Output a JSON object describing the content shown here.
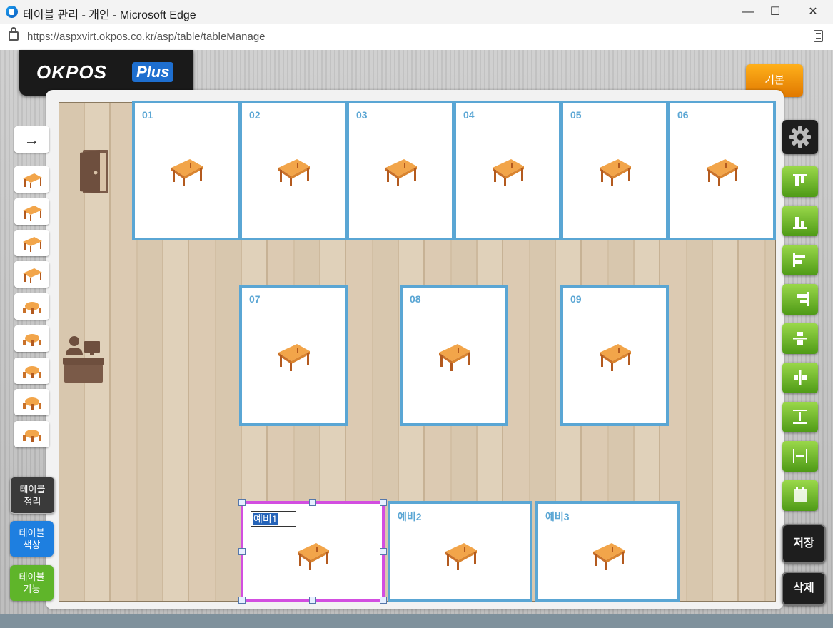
{
  "window": {
    "title": "테이블 관리 - 개인 - Microsoft Edge",
    "minimize": "—",
    "maximize": "☐",
    "close": "✕"
  },
  "address": {
    "url": "https://aspxvirt.okpos.co.kr/asp/table/tableManage"
  },
  "logo": {
    "brand": "OKPOS",
    "plus": "Plus"
  },
  "header": {
    "basic_label": "기본"
  },
  "tables": [
    {
      "label": "01"
    },
    {
      "label": "02"
    },
    {
      "label": "03"
    },
    {
      "label": "04"
    },
    {
      "label": "05"
    },
    {
      "label": "06"
    },
    {
      "label": "07"
    },
    {
      "label": "08"
    },
    {
      "label": "09"
    },
    {
      "label": "예비1"
    },
    {
      "label": "예비2"
    },
    {
      "label": "예비3"
    }
  ],
  "left_palette": {
    "arrow": "→",
    "items": [
      "table-1",
      "table-2",
      "table-4",
      "table-6",
      "round-2",
      "round-3",
      "round-4",
      "round-6",
      "round-8"
    ],
    "buttons": [
      {
        "line1": "테이블",
        "line2": "정리",
        "color": "#3a3a3a"
      },
      {
        "line1": "테이블",
        "line2": "색상",
        "color": "#1e7fe0"
      },
      {
        "line1": "테이블",
        "line2": "기능",
        "color": "#5fb52a"
      }
    ]
  },
  "right_toolbar": {
    "icons": [
      "settings-icon",
      "align-top-icon",
      "align-bottom-icon",
      "align-left-icon",
      "align-right-icon",
      "align-vcenter-icon",
      "align-hcenter-icon",
      "distribute-vertical-icon",
      "distribute-horizontal-icon",
      "same-size-icon"
    ],
    "save_label": "저장",
    "delete_label": "삭제"
  },
  "colors": {
    "tile_border": "#5aa6d4",
    "selected_border": "#d24ee0",
    "accent_orange": "#f29a00",
    "green_button": "#6cbf2a"
  }
}
